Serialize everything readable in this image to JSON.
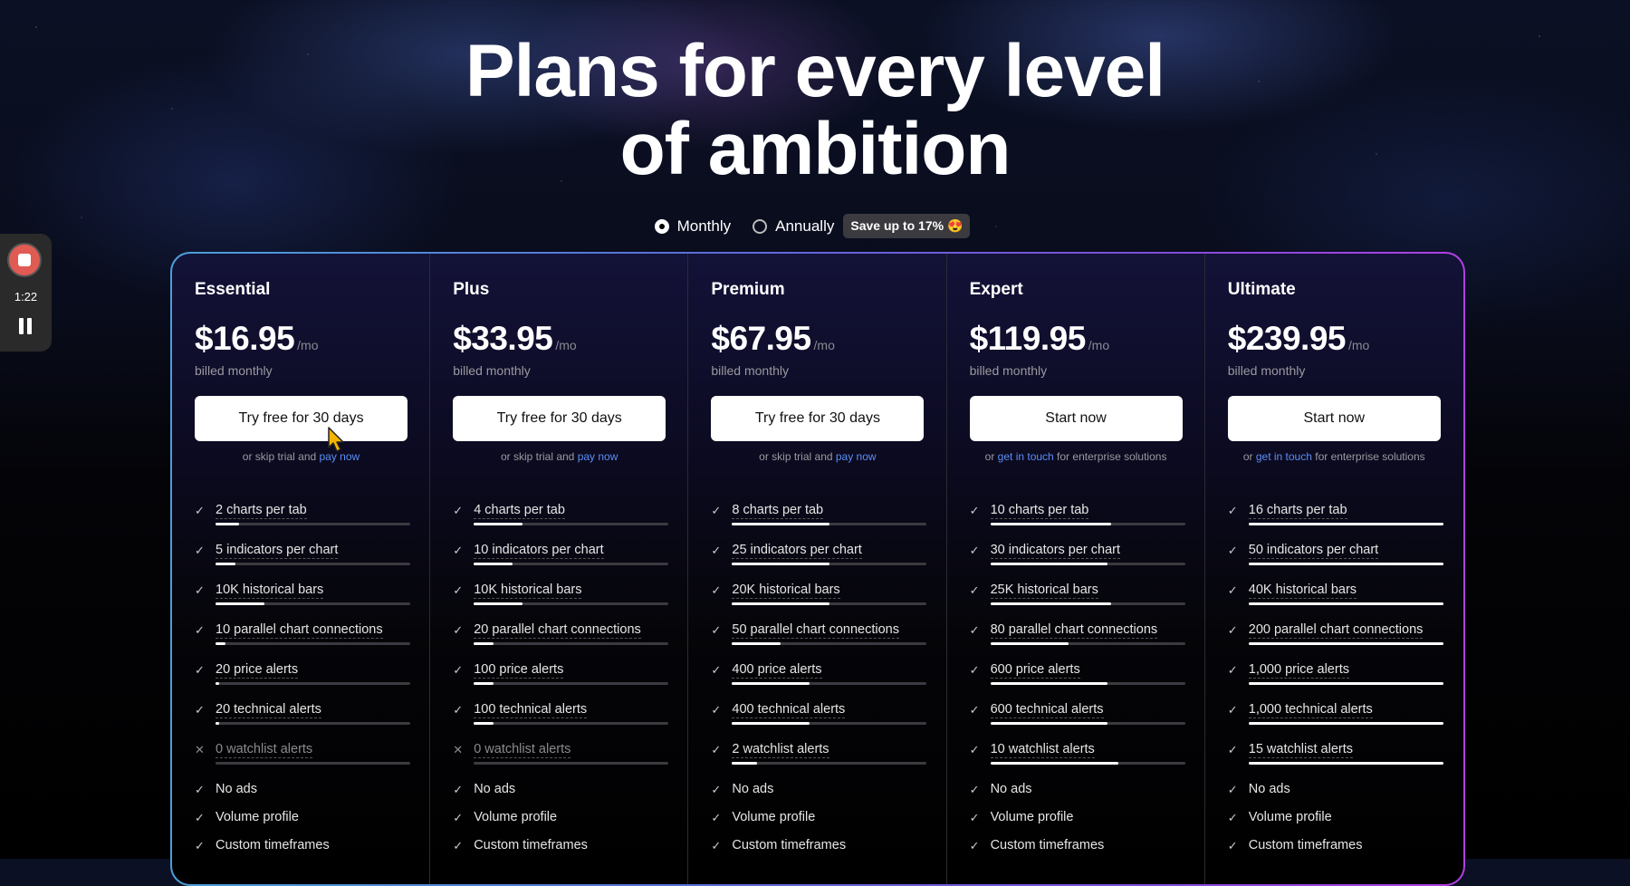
{
  "headline": "Plans for every level\nof ambition",
  "billing": {
    "monthly_label": "Monthly",
    "annually_label": "Annually",
    "selected": "monthly",
    "save_badge": "Save up to 17% 😍"
  },
  "recorder": {
    "time": "1:22"
  },
  "colors": {
    "link": "#5a8ef5",
    "record": "#e05b53"
  },
  "plans": [
    {
      "name": "Essential",
      "price": "$16.95",
      "per": "/mo",
      "billed": "billed monthly",
      "cta": "Try free for 30 days",
      "sub_before": "or skip trial and ",
      "sub_link": "pay now",
      "sub_after": "",
      "features": [
        {
          "text": "2 charts per tab",
          "included": true,
          "level": 0.12
        },
        {
          "text": "5 indicators per chart",
          "included": true,
          "level": 0.1
        },
        {
          "text": "10K historical bars",
          "included": true,
          "level": 0.25
        },
        {
          "text": "10 parallel chart connections",
          "included": true,
          "level": 0.05
        },
        {
          "text": "20 price alerts",
          "included": true,
          "level": 0.02
        },
        {
          "text": "20 technical alerts",
          "included": true,
          "level": 0.02
        },
        {
          "text": "0 watchlist alerts",
          "included": false,
          "level": 0
        },
        {
          "text": "No ads",
          "included": true
        },
        {
          "text": "Volume profile",
          "included": true
        },
        {
          "text": "Custom timeframes",
          "included": true
        }
      ]
    },
    {
      "name": "Plus",
      "price": "$33.95",
      "per": "/mo",
      "billed": "billed monthly",
      "cta": "Try free for 30 days",
      "sub_before": "or skip trial and ",
      "sub_link": "pay now",
      "sub_after": "",
      "features": [
        {
          "text": "4 charts per tab",
          "included": true,
          "level": 0.25
        },
        {
          "text": "10 indicators per chart",
          "included": true,
          "level": 0.2
        },
        {
          "text": "10K historical bars",
          "included": true,
          "level": 0.25
        },
        {
          "text": "20 parallel chart connections",
          "included": true,
          "level": 0.1
        },
        {
          "text": "100 price alerts",
          "included": true,
          "level": 0.1
        },
        {
          "text": "100 technical alerts",
          "included": true,
          "level": 0.1
        },
        {
          "text": "0 watchlist alerts",
          "included": false,
          "level": 0
        },
        {
          "text": "No ads",
          "included": true
        },
        {
          "text": "Volume profile",
          "included": true
        },
        {
          "text": "Custom timeframes",
          "included": true
        }
      ]
    },
    {
      "name": "Premium",
      "price": "$67.95",
      "per": "/mo",
      "billed": "billed monthly",
      "cta": "Try free for 30 days",
      "sub_before": "or skip trial and ",
      "sub_link": "pay now",
      "sub_after": "",
      "features": [
        {
          "text": "8 charts per tab",
          "included": true,
          "level": 0.5
        },
        {
          "text": "25 indicators per chart",
          "included": true,
          "level": 0.5
        },
        {
          "text": "20K historical bars",
          "included": true,
          "level": 0.5
        },
        {
          "text": "50 parallel chart connections",
          "included": true,
          "level": 0.25
        },
        {
          "text": "400 price alerts",
          "included": true,
          "level": 0.4
        },
        {
          "text": "400 technical alerts",
          "included": true,
          "level": 0.4
        },
        {
          "text": "2 watchlist alerts",
          "included": true,
          "level": 0.13
        },
        {
          "text": "No ads",
          "included": true
        },
        {
          "text": "Volume profile",
          "included": true
        },
        {
          "text": "Custom timeframes",
          "included": true
        }
      ]
    },
    {
      "name": "Expert",
      "price": "$119.95",
      "per": "/mo",
      "billed": "billed monthly",
      "cta": "Start now",
      "sub_before": "or ",
      "sub_link": "get in touch",
      "sub_after": " for enterprise solutions",
      "features": [
        {
          "text": "10 charts per tab",
          "included": true,
          "level": 0.62
        },
        {
          "text": "30 indicators per chart",
          "included": true,
          "level": 0.6
        },
        {
          "text": "25K historical bars",
          "included": true,
          "level": 0.62
        },
        {
          "text": "80 parallel chart connections",
          "included": true,
          "level": 0.4
        },
        {
          "text": "600 price alerts",
          "included": true,
          "level": 0.6
        },
        {
          "text": "600 technical alerts",
          "included": true,
          "level": 0.6
        },
        {
          "text": "10 watchlist alerts",
          "included": true,
          "level": 0.66
        },
        {
          "text": "No ads",
          "included": true
        },
        {
          "text": "Volume profile",
          "included": true
        },
        {
          "text": "Custom timeframes",
          "included": true
        }
      ]
    },
    {
      "name": "Ultimate",
      "price": "$239.95",
      "per": "/mo",
      "billed": "billed monthly",
      "cta": "Start now",
      "sub_before": "or ",
      "sub_link": "get in touch",
      "sub_after": " for enterprise solutions",
      "features": [
        {
          "text": "16 charts per tab",
          "included": true,
          "level": 1
        },
        {
          "text": "50 indicators per chart",
          "included": true,
          "level": 1
        },
        {
          "text": "40K historical bars",
          "included": true,
          "level": 1
        },
        {
          "text": "200 parallel chart connections",
          "included": true,
          "level": 1
        },
        {
          "text": "1,000 price alerts",
          "included": true,
          "level": 1
        },
        {
          "text": "1,000 technical alerts",
          "included": true,
          "level": 1
        },
        {
          "text": "15 watchlist alerts",
          "included": true,
          "level": 1
        },
        {
          "text": "No ads",
          "included": true
        },
        {
          "text": "Volume profile",
          "included": true
        },
        {
          "text": "Custom timeframes",
          "included": true
        }
      ]
    }
  ]
}
